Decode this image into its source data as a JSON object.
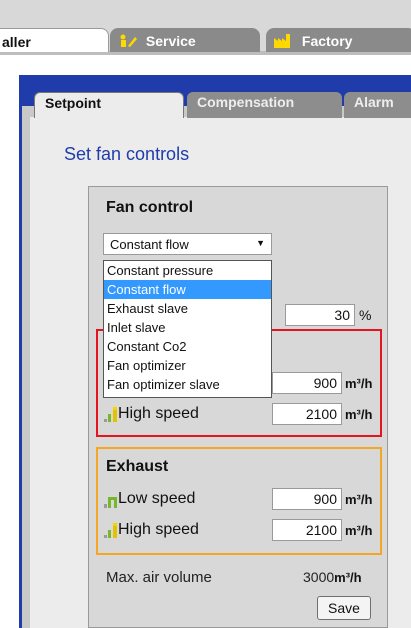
{
  "top_tabs": {
    "installer": "aller",
    "service": "Service",
    "factory": "Factory"
  },
  "sub_tabs": {
    "setpoint": "Setpoint",
    "compensation": "Compensation",
    "alarm": "Alarm"
  },
  "page_title": "Set fan controls",
  "fan_control": {
    "title": "Fan control",
    "selected": "Constant flow",
    "options": [
      "Constant pressure",
      "Constant flow",
      "Exhaust slave",
      "Inlet slave",
      "Constant Co2",
      "Fan optimizer",
      "Fan optimizer slave"
    ],
    "percent_value": "30",
    "percent_unit": "%"
  },
  "supply": {
    "low_speed_value": "900",
    "low_speed_unit": "m³/h",
    "high_speed_label": "High speed",
    "high_speed_value": "2100",
    "high_speed_unit": "m³/h"
  },
  "exhaust": {
    "title": "Exhaust",
    "low_speed_label": "Low speed",
    "low_speed_value": "900",
    "low_speed_unit": "m³/h",
    "high_speed_label": "High speed",
    "high_speed_value": "2100",
    "high_speed_unit": "m³/h"
  },
  "max_air": {
    "label": "Max. air volume",
    "value": "3000",
    "unit": "m³/h"
  },
  "save_label": "Save",
  "colors": {
    "nav_blue": "#1f3caa",
    "supply_border": "#e5141e",
    "exhaust_border": "#f5a623",
    "selection": "#3399ff"
  }
}
